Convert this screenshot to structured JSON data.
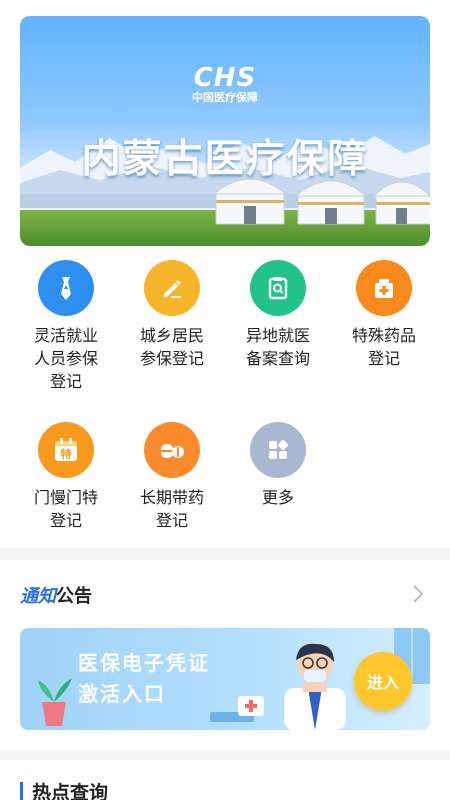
{
  "banner": {
    "logo_mark": "CHS",
    "logo_sub": "中国医疗保障",
    "title": "内蒙古医疗保障"
  },
  "services": [
    {
      "label_lines": [
        "灵活就业",
        "人员参保",
        "登记"
      ],
      "icon": "necktie-icon",
      "color": "#2f8ff0"
    },
    {
      "label_lines": [
        "城乡居民",
        "参保登记"
      ],
      "icon": "edit-pencil-icon",
      "color": "#f7b52c"
    },
    {
      "label_lines": [
        "异地就医",
        "备案查询"
      ],
      "icon": "clipboard-search-icon",
      "color": "#22c38a"
    },
    {
      "label_lines": [
        "特殊药品",
        "登记"
      ],
      "icon": "medicine-box-icon",
      "color": "#fa8a1c"
    },
    {
      "label_lines": [
        "门慢门特",
        "登记"
      ],
      "icon": "calendar-special-icon",
      "icon_text": "特",
      "color": "#f79a1e"
    },
    {
      "label_lines": [
        "长期带药",
        "登记"
      ],
      "icon": "pill-capsule-icon",
      "color": "#fb8a2c"
    },
    {
      "label_lines": [
        "更多"
      ],
      "icon": "more-apps-icon",
      "color": "#aab7d3"
    }
  ],
  "notice": {
    "title_blue": "通知",
    "title_rest": "公告",
    "card_line1": "医保电子凭证",
    "card_line2": "激活入口",
    "card_button": "进入"
  },
  "hot": {
    "title": "热点查询"
  }
}
